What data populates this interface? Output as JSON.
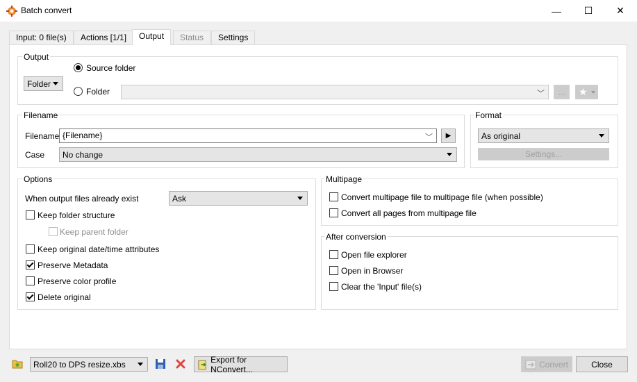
{
  "window": {
    "title": "Batch convert",
    "minimize_icon": "minimize-icon",
    "maximize_icon": "maximize-icon",
    "close_icon": "close-icon",
    "minimize_glyph": "—",
    "maximize_glyph": "☐",
    "close_glyph": "✕"
  },
  "tabs": [
    {
      "label": "Input: 0 file(s)"
    },
    {
      "label": "Actions [1/1]"
    },
    {
      "label": "Output"
    },
    {
      "label": "Status"
    },
    {
      "label": "Settings"
    }
  ],
  "output": {
    "group_title": "Output",
    "mode_selected": "Folder",
    "source_folder_label": "Source folder",
    "folder_label": "Folder",
    "folder_value": "",
    "browse_label": "...",
    "star_glyph": "★",
    "source_folder_checked": true
  },
  "filename": {
    "group_title": "Filename",
    "filename_label": "Filename",
    "filename_value": "{Filename}",
    "case_label": "Case",
    "case_value": "No change",
    "play_glyph": "▶"
  },
  "format": {
    "group_title": "Format",
    "format_value": "As original",
    "settings_label": "Settings..."
  },
  "options": {
    "group_title": "Options",
    "exist_label": "When output files already exist",
    "exist_value": "Ask",
    "items": [
      {
        "label": "Keep folder structure",
        "checked": false
      },
      {
        "label": "Keep parent folder",
        "checked": false
      },
      {
        "label": "Keep original date/time attributes",
        "checked": false
      },
      {
        "label": "Preserve Metadata",
        "checked": true
      },
      {
        "label": "Preserve color profile",
        "checked": false
      },
      {
        "label": "Delete original",
        "checked": true
      }
    ]
  },
  "multipage": {
    "group_title": "Multipage",
    "items": [
      {
        "label": "Convert multipage file to multipage file (when possible)",
        "checked": false
      },
      {
        "label": "Convert all pages from multipage file",
        "checked": false
      }
    ]
  },
  "after_conversion": {
    "group_title": "After conversion",
    "items": [
      {
        "label": "Open file explorer",
        "checked": false
      },
      {
        "label": "Open in Browser",
        "checked": false
      },
      {
        "label": "Clear the 'Input' file(s)",
        "checked": false
      }
    ]
  },
  "footer": {
    "preset_value": "Roll20 to DPS resize.xbs",
    "export_label": "Export for NConvert...",
    "convert_label": "Convert",
    "close_label": "Close"
  },
  "colors": {
    "delete_icon": "#e04545",
    "save_icon": "#2d5fb3",
    "folder_icon": "#e8c042"
  }
}
